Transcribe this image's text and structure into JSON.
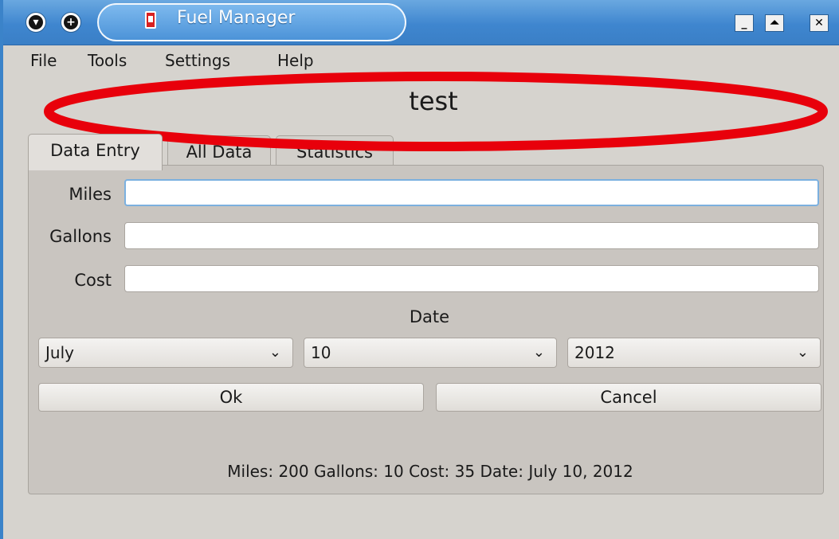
{
  "window": {
    "title": "Fuel Manager",
    "buttons": {
      "menu": "▾",
      "add": "+",
      "minimize": "_",
      "maximize": "⏶",
      "close": "✕"
    }
  },
  "menu": {
    "items": [
      "File",
      "Tools",
      "Settings",
      "Help"
    ]
  },
  "header": {
    "title": "test"
  },
  "tabs": [
    {
      "label": "Data Entry",
      "active": true
    },
    {
      "label": "All Data",
      "active": false
    },
    {
      "label": "Statistics",
      "active": false
    }
  ],
  "form": {
    "miles": {
      "label": "Miles",
      "value": ""
    },
    "gallons": {
      "label": "Gallons",
      "value": ""
    },
    "cost": {
      "label": "Cost",
      "value": ""
    },
    "date_label": "Date",
    "month": "July",
    "day": "10",
    "year": "2012",
    "ok_label": "Ok",
    "cancel_label": "Cancel"
  },
  "status": "Miles: 200 Gallons: 10 Cost: 35 Date: July 10, 2012",
  "colors": {
    "titlebar": "#3f86cf",
    "annotation": "#e8000b",
    "panel": "#c9c5c0"
  }
}
